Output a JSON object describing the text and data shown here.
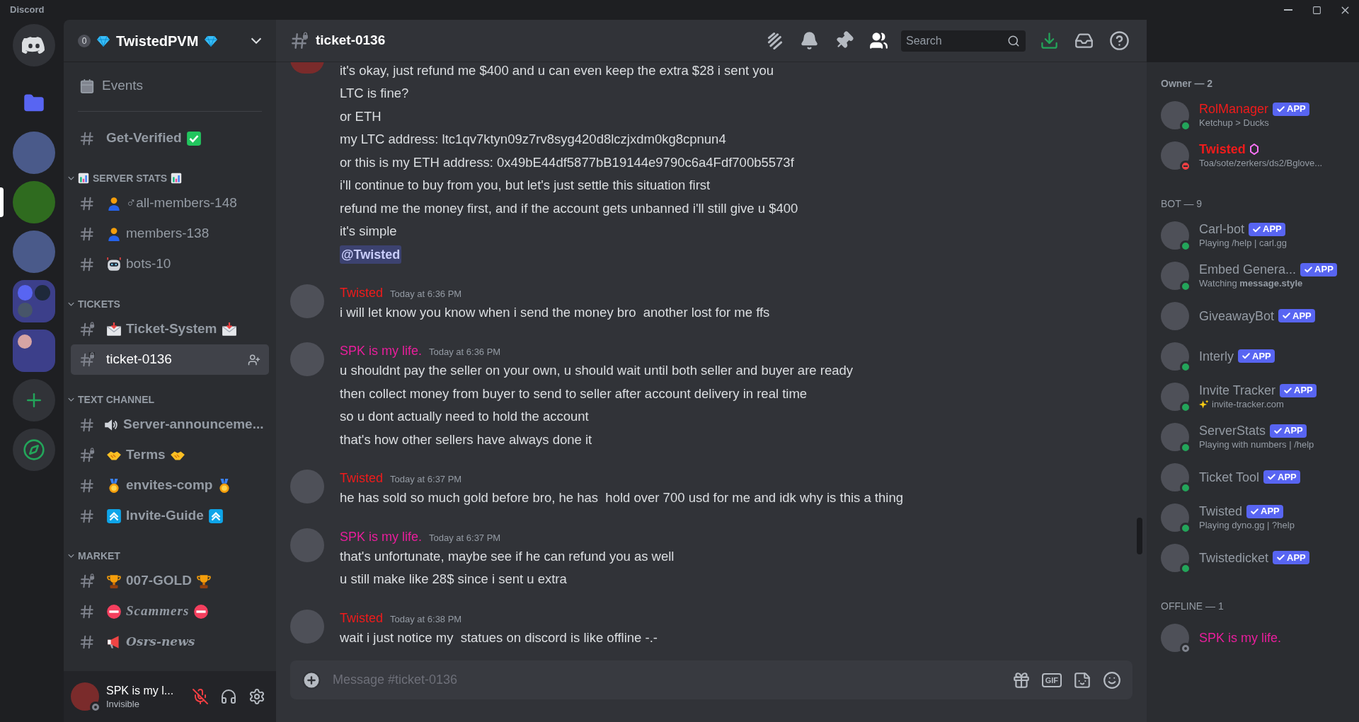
{
  "window": {
    "title": "Discord"
  },
  "servers": [
    {
      "kind": "home",
      "selected": false
    },
    {
      "kind": "folder",
      "selected": false
    },
    {
      "kind": "photo",
      "selected": false
    },
    {
      "kind": "photo",
      "selected": true
    },
    {
      "kind": "photo",
      "selected": false
    },
    {
      "kind": "folder-group",
      "selected": false
    },
    {
      "kind": "folder-single",
      "selected": false
    },
    {
      "kind": "add",
      "selected": false
    },
    {
      "kind": "discover",
      "selected": false
    }
  ],
  "server": {
    "name": "TwistedPVM",
    "boost_level": "0"
  },
  "sidebar": {
    "items": [
      {
        "kind": "events",
        "name": "Events"
      },
      {
        "kind": "divider"
      },
      {
        "kind": "channel",
        "name": "Get-Verified",
        "locked": false,
        "selected": false
      },
      {
        "kind": "category",
        "name": "SERVER STATS",
        "expanded": true
      },
      {
        "kind": "channel",
        "name": "♂all-members-148",
        "locked": false,
        "selected": false
      },
      {
        "kind": "channel",
        "name": "members-138",
        "locked": false,
        "selected": false
      },
      {
        "kind": "channel",
        "name": "bots-10",
        "locked": false,
        "selected": false
      },
      {
        "kind": "category",
        "name": "TICKETS",
        "expanded": true
      },
      {
        "kind": "channel",
        "name": "Ticket-System",
        "locked": true,
        "selected": false
      },
      {
        "kind": "channel",
        "name": "ticket-0136",
        "locked": true,
        "selected": true
      },
      {
        "kind": "category",
        "name": "TEXT CHANNEL",
        "expanded": true
      },
      {
        "kind": "channel",
        "name": "Server-announceme...",
        "locked": false,
        "selected": false
      },
      {
        "kind": "channel",
        "name": "Terms",
        "locked": true,
        "selected": false
      },
      {
        "kind": "channel",
        "name": "envites-comp",
        "locked": false,
        "selected": false
      },
      {
        "kind": "channel",
        "name": "Invite-Guide",
        "locked": false,
        "selected": false
      },
      {
        "kind": "category",
        "name": "MARKET",
        "expanded": true
      },
      {
        "kind": "channel",
        "name": "007-GOLD",
        "locked": true,
        "selected": false
      },
      {
        "kind": "channel",
        "name": "Scammers",
        "locked": false,
        "selected": false
      },
      {
        "kind": "channel",
        "name": "Osrs-news",
        "locked": false,
        "selected": false
      }
    ]
  },
  "user_panel": {
    "name": "SPK is my l...",
    "status": "Invisible",
    "muted": true
  },
  "channel_header": {
    "name": "ticket-0136",
    "locked": true
  },
  "toolbar": [
    {
      "kind": "threads",
      "active": false
    },
    {
      "kind": "bell",
      "active": false
    },
    {
      "kind": "pin",
      "active": false
    },
    {
      "kind": "members",
      "active": true
    }
  ],
  "search": {
    "placeholder": "Search"
  },
  "messages": [
    {
      "continued": true,
      "lines": [
        {
          "kind": "text",
          "text": "it's okay, just refund me $400 and u can even keep the extra $28 i sent you"
        },
        {
          "kind": "text",
          "text": "LTC is fine?"
        },
        {
          "kind": "text",
          "text": "or ETH"
        },
        {
          "kind": "text",
          "text": "my LTC address: ltc1qv7ktyn09z7rv8syg420d8lczjxdm0kg8cpnun4"
        },
        {
          "kind": "text",
          "text": "or this is my ETH address: 0x49bE44df5877bB19144e9790c6a4Fdf700b5573f"
        },
        {
          "kind": "text",
          "text": "i'll continue to buy from you, but let's just settle this situation first"
        },
        {
          "kind": "text",
          "text": "refund me the money first, and if the account gets unbanned i'll still give u $400"
        },
        {
          "kind": "text",
          "text": "it's simple"
        },
        {
          "kind": "mention",
          "text": "@Twisted"
        }
      ]
    },
    {
      "continued": false,
      "author": "Twisted",
      "color": "#f01b1b",
      "time": "Today at 6:36 PM",
      "lines": [
        {
          "kind": "text",
          "text": "i will let know you know when i send the money bro  another lost for me ffs"
        }
      ]
    },
    {
      "continued": false,
      "author": "SPK is my life.",
      "color": "#e91e9c",
      "time": "Today at 6:36 PM",
      "lines": [
        {
          "kind": "text",
          "text": "u shouldnt pay the seller on your own, u should wait until both seller and buyer are ready"
        },
        {
          "kind": "text",
          "text": "then collect money from buyer to send to seller after account delivery in real time"
        },
        {
          "kind": "text",
          "text": "so u dont actually need to hold the account"
        },
        {
          "kind": "text",
          "text": "that's how other sellers have always done it"
        }
      ]
    },
    {
      "continued": false,
      "author": "Twisted",
      "color": "#f01b1b",
      "time": "Today at 6:37 PM",
      "lines": [
        {
          "kind": "text",
          "text": "he has sold so much gold before bro, he has  hold over 700 usd for me and idk why is this a thing"
        }
      ]
    },
    {
      "continued": false,
      "author": "SPK is my life.",
      "color": "#e91e9c",
      "time": "Today at 6:37 PM",
      "lines": [
        {
          "kind": "text",
          "text": "that's unfortunate, maybe see if he can refund you as well"
        },
        {
          "kind": "text",
          "text": "u still make like 28$ since i sent u extra"
        }
      ]
    },
    {
      "continued": false,
      "author": "Twisted",
      "color": "#f01b1b",
      "time": "Today at 6:38 PM",
      "lines": [
        {
          "kind": "text",
          "text": "wait i just notice my  statues on discord is like offline -.-"
        }
      ]
    }
  ],
  "composer": {
    "placeholder": "Message #ticket-0136",
    "gif_label": "GIF"
  },
  "members": [
    {
      "title": "Owner — 2",
      "members": [
        {
          "name": "RolManager",
          "color": "#f01b1b",
          "bold": false,
          "badge": "APP",
          "online": true,
          "activity": "Ketchup > Ducks"
        },
        {
          "name": "Twisted",
          "color": "#f01b1b",
          "bold": true,
          "boost": true,
          "dnd": true,
          "activity": "Toa/sote/zerkers/ds2/Bglove..."
        }
      ]
    },
    {
      "title": "BOT — 9",
      "members": [
        {
          "name": "Carl-bot",
          "color": "#949ba4",
          "bold": false,
          "badge": "APP",
          "online": true,
          "activity": "Playing /help | carl.gg"
        },
        {
          "name": "Embed Genera...",
          "color": "#949ba4",
          "bold": false,
          "badge": "APP",
          "online": true,
          "activity": "Watching **message.style**"
        },
        {
          "name": "GiveawayBot",
          "color": "#949ba4",
          "bold": false,
          "badge": "APP",
          "online": false
        },
        {
          "name": "Interly",
          "color": "#949ba4",
          "bold": false,
          "badge": "APP",
          "online": true
        },
        {
          "name": "Invite Tracker",
          "color": "#949ba4",
          "bold": false,
          "badge": "APP",
          "online": true,
          "activity": "invite-tracker.com"
        },
        {
          "name": "ServerStats",
          "color": "#949ba4",
          "bold": false,
          "badge": "APP",
          "online": true,
          "activity": "Playing with numbers | /help"
        },
        {
          "name": "Ticket Tool",
          "color": "#949ba4",
          "bold": false,
          "badge": "APP",
          "online": true
        },
        {
          "name": "Twisted",
          "color": "#949ba4",
          "bold": false,
          "badge": "APP",
          "online": true,
          "activity": "Playing dyno.gg | ?help"
        },
        {
          "name": "Twistedicket",
          "color": "#949ba4",
          "bold": false,
          "badge": "APP",
          "online": true
        }
      ]
    },
    {
      "title": "OFFLINE — 1",
      "members": [
        {
          "name": "SPK is my life.",
          "color": "#e91e9c",
          "bold": false,
          "offline": true
        }
      ]
    }
  ]
}
